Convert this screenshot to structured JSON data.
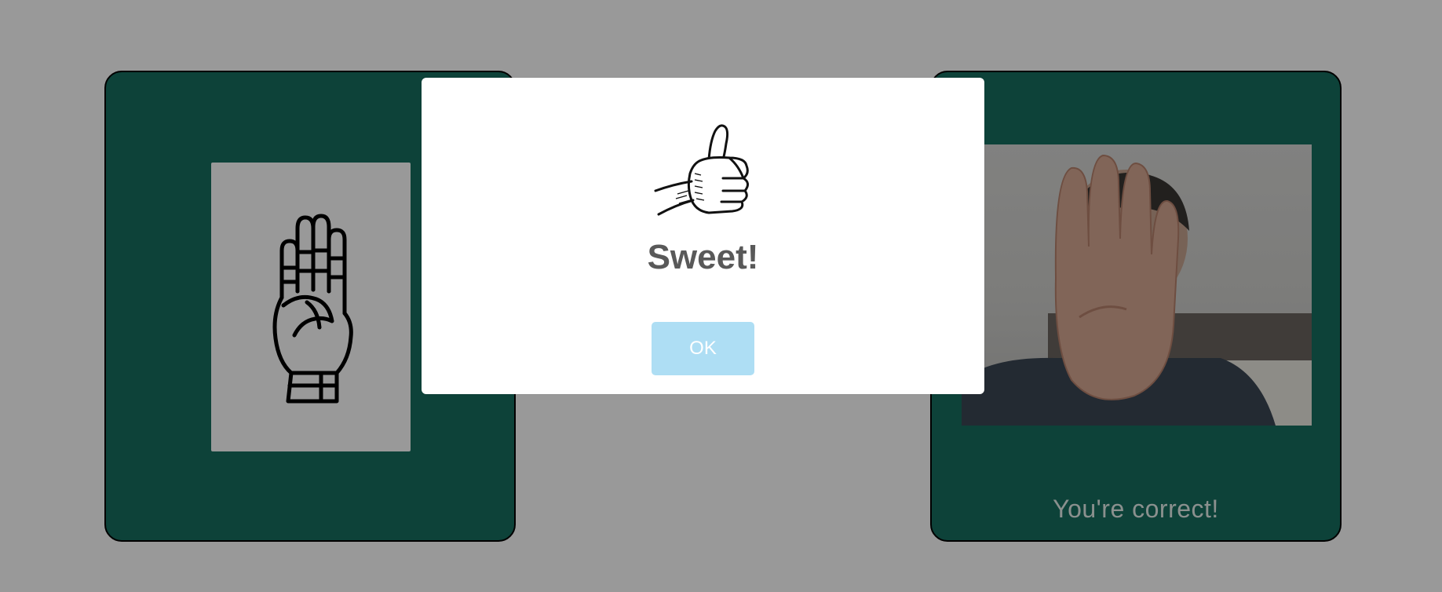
{
  "reference_panel": {
    "sign_image_icon": "asl-letter-b-hand-icon"
  },
  "camera_panel": {
    "camera_feed_icon": "webcam-feed",
    "feedback_text": "You're correct!"
  },
  "modal": {
    "icon": "thumbs-up-icon",
    "title": "Sweet!",
    "ok_label": "OK"
  },
  "colors": {
    "panel_bg": "#176f5f",
    "overlay": "rgba(0,0,0,0.40)",
    "button_bg": "#aedef4",
    "title_text": "#595959"
  }
}
